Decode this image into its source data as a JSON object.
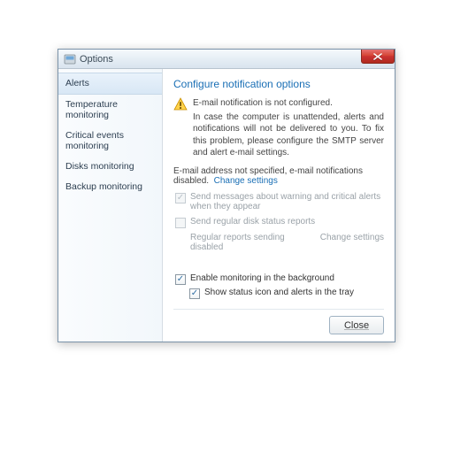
{
  "titlebar": {
    "title": "Options"
  },
  "sidebar": {
    "items": [
      {
        "label": "Alerts",
        "selected": true
      },
      {
        "label": "Temperature monitoring"
      },
      {
        "label": "Critical events monitoring"
      },
      {
        "label": "Disks monitoring"
      },
      {
        "label": "Backup monitoring"
      }
    ]
  },
  "main": {
    "heading": "Configure notification options",
    "warning": {
      "line1": "E-mail notification is not configured.",
      "line2": "In case the computer is unattended, alerts and notifications will not be delivered to you. To fix this problem, please configure the SMTP server and alert e-mail settings."
    },
    "status_text": "E-mail address not specified, e-mail notifications disabled.",
    "change_settings": "Change settings",
    "checks": {
      "send_warning": "Send messages about warning and critical alerts when they appear",
      "send_reports": "Send regular disk status reports",
      "reports_sub": "Regular reports sending disabled",
      "reports_change": "Change settings"
    },
    "bottom": {
      "enable_bg": "Enable monitoring in the background",
      "show_tray": "Show status icon and alerts in the tray"
    },
    "close": "Close"
  }
}
